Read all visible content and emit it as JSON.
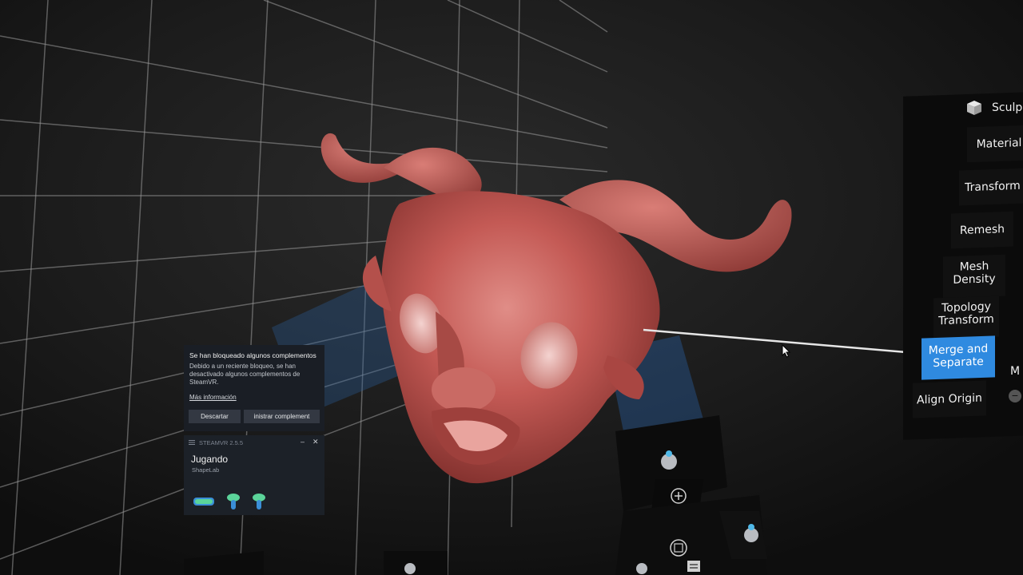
{
  "vr_menu": {
    "header": "Sculp",
    "items": [
      {
        "label": "Material",
        "active": false
      },
      {
        "label": "Transform",
        "active": false
      },
      {
        "label": "Remesh",
        "active": false
      },
      {
        "label": "Mesh Density",
        "line1": "Mesh",
        "line2": "Density",
        "active": false
      },
      {
        "label": "Topology Transform",
        "line1": "Topology",
        "line2": "Transform",
        "active": false
      },
      {
        "label": "Merge and Separate",
        "line1": "Merge and",
        "line2": "Separate",
        "active": true
      },
      {
        "label": "Align Origin",
        "active": false
      }
    ],
    "side_partial": "M",
    "accent_color": "#2f8ae0"
  },
  "notification": {
    "title": "Se han bloqueado algunos complementos",
    "body": "Debido a un reciente bloqueo, se han desactivado algunos complementos de SteamVR.",
    "link": "Más información",
    "dismiss_label": "Descartar",
    "manage_label": "inistrar complement"
  },
  "steamvr_status": {
    "version": "STEAMVR 2.5.5",
    "title": "Jugando",
    "app": "ShapeLab",
    "devices": [
      "headset-icon",
      "controller-left-icon",
      "controller-right-icon"
    ]
  },
  "model": {
    "name": "horned-mask",
    "color": "#c45a55"
  }
}
